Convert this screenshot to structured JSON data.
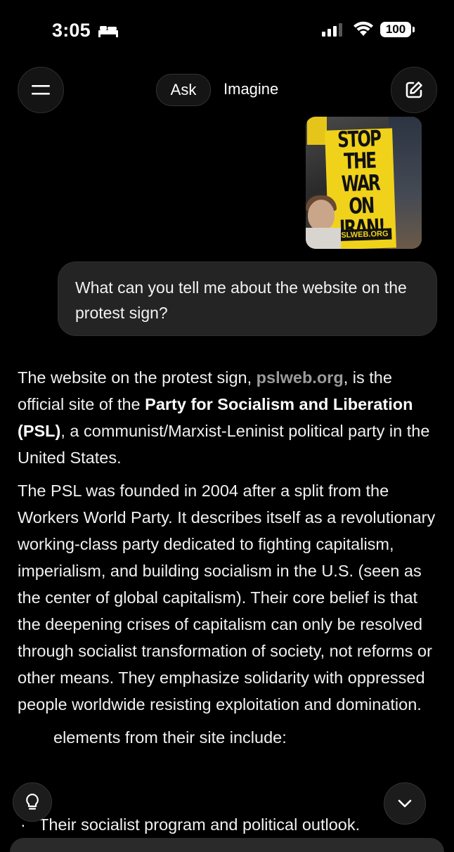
{
  "status_bar": {
    "time": "3:05",
    "battery": "100"
  },
  "header": {
    "tab_ask": "Ask",
    "tab_imagine": "Imagine"
  },
  "attachment": {
    "sign_lines": [
      "STOP THE",
      "WAR",
      "ON IRAN!"
    ],
    "sign_url": "PSLWEB.ORG"
  },
  "user_message": "What can you tell me about the website on the protest sign?",
  "response": {
    "p1_a": "The website on the protest sign, ",
    "p1_link": "pslweb.org",
    "p1_b": ", is the official site of the ",
    "p1_bold": "Party for Socialism and Liberation (PSL)",
    "p1_c": ", a communist/Marxist-Leninist political party in the United States.",
    "p2": "The PSL was founded in 2004 after a split from the Workers World Party. It describes itself as a revolutionary working-class party dedicated to fighting capitalism, imperialism, and building socialism in the U.S. (seen as the center of global capitalism). Their core belief is that the deepening crises of capitalism can only be resolved through socialist transformation of society, not reforms or other means. They emphasize solidarity with oppressed people worldwide resisting exploitation and domination.",
    "p3": "elements from their site include:",
    "list_item_1": "Their socialist program and political outlook."
  },
  "icons": [
    "bed-icon",
    "signal-icon",
    "wifi-icon",
    "battery-icon",
    "menu-icon",
    "edit-icon",
    "lightbulb-icon",
    "chevron-down-icon"
  ]
}
